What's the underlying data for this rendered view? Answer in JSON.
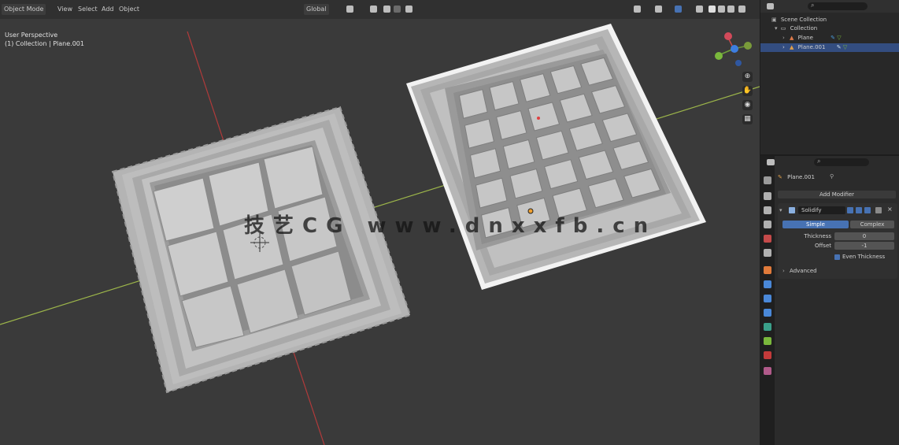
{
  "viewport_header": {
    "mode": "Object Mode",
    "menus": [
      "View",
      "Select",
      "Add",
      "Object"
    ],
    "pivot": "Global"
  },
  "viewport_hud": {
    "view_name": "User Perspective",
    "collection": "(1) Collection | Plane.001"
  },
  "watermark": "技艺CG  www.dnxxfb.cn",
  "outliner": {
    "items": [
      {
        "label": "Scene Collection",
        "selected": false
      },
      {
        "label": "Collection",
        "selected": false
      },
      {
        "label": "Plane",
        "selected": false
      },
      {
        "label": "Plane.001",
        "selected": true
      }
    ]
  },
  "properties": {
    "object": "Plane.001",
    "add_modifier": "Add Modifier",
    "modifier_name": "Solidify",
    "tabs": [
      "Simple",
      "Complex"
    ],
    "fields": [
      {
        "label": "Thickness",
        "value": "0"
      },
      {
        "label": "Offset",
        "value": "-1"
      }
    ],
    "even_thickness": "Even Thickness",
    "advanced": "Advanced"
  },
  "colors": {
    "viewport_bg": "#3a3a3a",
    "selection_outline": "#f2f2f2",
    "x_axis": "#b03a3a",
    "y_axis": "#9cb54a",
    "active_blue": "#4772b3"
  }
}
